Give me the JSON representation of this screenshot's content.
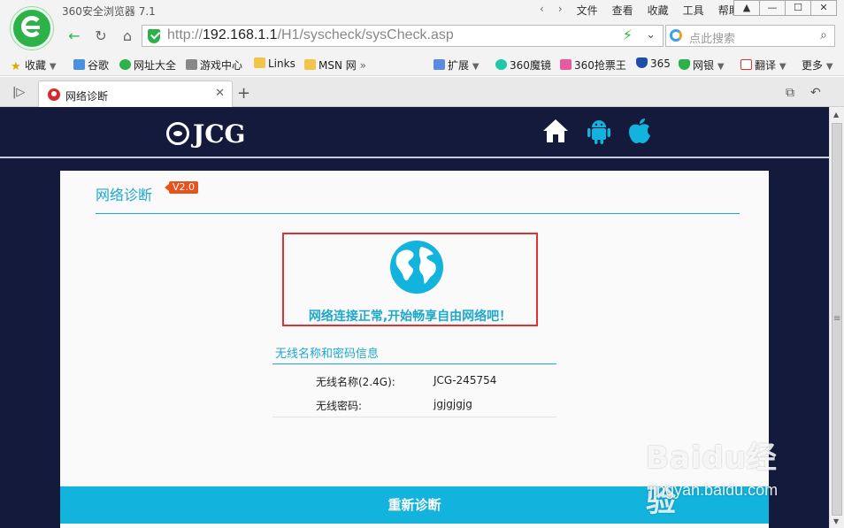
{
  "browser": {
    "app_title": "360安全浏览器 7.1",
    "menu": [
      "文件",
      "查看",
      "收藏",
      "工具",
      "帮助"
    ],
    "url_prefix": "http://",
    "url_host": "192.168.1.1",
    "url_path": "/H1/syscheck/sysCheck.asp",
    "search_placeholder": "点此搜索",
    "bookmarks": [
      "收藏",
      "谷歌",
      "网址大全",
      "游戏中心",
      "Links",
      "MSN 网",
      "扩展",
      "360魔镜",
      "360抢票王",
      "365",
      "网银",
      "翻译",
      "更多"
    ],
    "tab_title": "网络诊断"
  },
  "header": {
    "logo_text": "JCG"
  },
  "panel": {
    "title": "网络诊断",
    "badge": "V2.0",
    "status_message": "网络连接正常,开始畅享自由网络吧！",
    "wifi_section_title": "无线名称和密码信息",
    "ssid_label": "无线名称(2.4G):",
    "ssid_value": "JCG-245754",
    "password_label": "无线密码:",
    "password_value": "jgjgjgjg",
    "rediagnose_button": "重新诊断"
  },
  "watermark": {
    "main": "Baidu经验",
    "sub": "jingyan.baidu.com"
  },
  "colors": {
    "accent": "#1ea8cd",
    "page_bg": "#141a3c",
    "highlight_border": "#e03232",
    "badge": "#e8521c"
  }
}
